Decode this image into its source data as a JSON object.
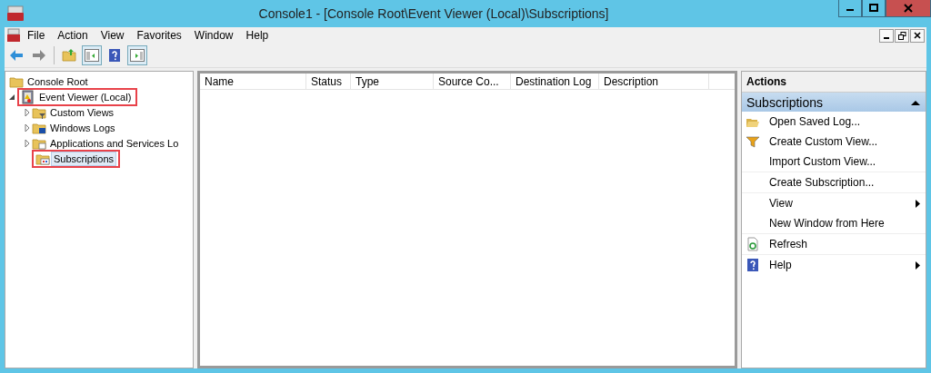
{
  "window": {
    "title": "Console1 - [Console Root\\Event Viewer (Local)\\Subscriptions]"
  },
  "menu": [
    "File",
    "Action",
    "View",
    "Favorites",
    "Window",
    "Help"
  ],
  "tree": [
    {
      "label": "Console Root",
      "kind": "folder",
      "highlighted": false,
      "children": [
        {
          "label": "Event Viewer (Local)",
          "kind": "eventviewer",
          "expanded": true,
          "highlighted": true,
          "children": [
            {
              "label": "Custom Views",
              "kind": "filterfolder",
              "expanded": false,
              "highlighted": false
            },
            {
              "label": "Windows Logs",
              "kind": "logfolder",
              "expanded": false,
              "highlighted": false
            },
            {
              "label": "Applications and Services Lo",
              "kind": "appfolder",
              "expanded": false,
              "highlighted": false
            },
            {
              "label": "Subscriptions",
              "kind": "subfolder",
              "selected": true,
              "highlighted": true
            }
          ]
        }
      ]
    }
  ],
  "table": {
    "columns": [
      "Name",
      "Status",
      "Type",
      "Source Co...",
      "Destination Log",
      "Description"
    ]
  },
  "actions": {
    "title": "Actions",
    "section": "Subscriptions",
    "groups": [
      [
        {
          "label": "Open Saved Log...",
          "kind": "openfolder",
          "submenu": false
        },
        {
          "label": "Create Custom View...",
          "kind": "filter",
          "submenu": false
        },
        {
          "label": "Import Custom View...",
          "kind": "plain",
          "submenu": false
        }
      ],
      [
        {
          "label": "Create Subscription...",
          "kind": "plain",
          "submenu": false
        }
      ],
      [
        {
          "label": "View",
          "kind": "plain",
          "submenu": true
        },
        {
          "label": "New Window from Here",
          "kind": "plain",
          "submenu": false
        }
      ],
      [
        {
          "label": "Refresh",
          "kind": "refresh",
          "submenu": false
        }
      ],
      [
        {
          "label": "Help",
          "kind": "help",
          "submenu": true
        }
      ]
    ]
  }
}
